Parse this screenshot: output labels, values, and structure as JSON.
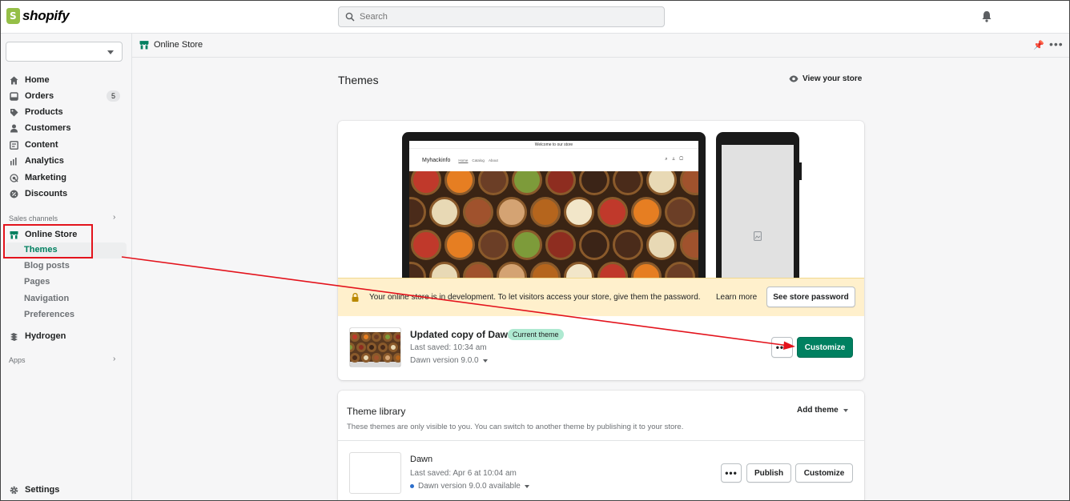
{
  "app": {
    "brand": "shopify"
  },
  "topbar": {
    "search_placeholder": "Search",
    "bell_icon": "bell-icon"
  },
  "sidebar": {
    "store_select_value": "",
    "items": [
      {
        "label": "Home",
        "icon": "home-icon"
      },
      {
        "label": "Orders",
        "icon": "orders-icon",
        "badge": "5"
      },
      {
        "label": "Products",
        "icon": "tag-icon"
      },
      {
        "label": "Customers",
        "icon": "person-icon"
      },
      {
        "label": "Content",
        "icon": "content-icon"
      },
      {
        "label": "Analytics",
        "icon": "analytics-icon"
      },
      {
        "label": "Marketing",
        "icon": "marketing-icon"
      },
      {
        "label": "Discounts",
        "icon": "discount-icon"
      }
    ],
    "sales_channels_label": "Sales channels",
    "online_store_label": "Online Store",
    "sub_items": [
      "Themes",
      "Blog posts",
      "Pages",
      "Navigation",
      "Preferences"
    ],
    "hydrogen_label": "Hydrogen",
    "apps_label": "Apps",
    "settings_label": "Settings",
    "active_color": "#008060"
  },
  "breadcrumb": {
    "label": "Online Store"
  },
  "main": {
    "title": "Themes",
    "view_store": "View your store",
    "preview": {
      "announcement": "Welcome to our store",
      "site_brand": "Myhackinfo",
      "nav": [
        "Home",
        "Catalog",
        "About"
      ]
    },
    "banner": {
      "text": "Your online store is in development. To let visitors access your store, give them the password.",
      "learn_more": "Learn more",
      "button": "See store password",
      "bg_color": "#fff0cc"
    },
    "current_theme": {
      "name": "Updated copy of Dawn",
      "badge": "Current theme",
      "saved": "Last saved: 10:34 am",
      "version": "Dawn version 9.0.0",
      "more": "•••",
      "customize": "Customize"
    },
    "library": {
      "title": "Theme library",
      "add_theme": "Add theme",
      "description": "These themes are only visible to you. You can switch to another theme by publishing it to your store.",
      "themes": [
        {
          "name": "Dawn",
          "saved": "Last saved: Apr 6 at 10:04 am",
          "version": "Dawn version 9.0.0 available",
          "more": "•••",
          "publish": "Publish",
          "customize": "Customize"
        }
      ]
    }
  },
  "annotation": {
    "color": "#e3131c"
  }
}
